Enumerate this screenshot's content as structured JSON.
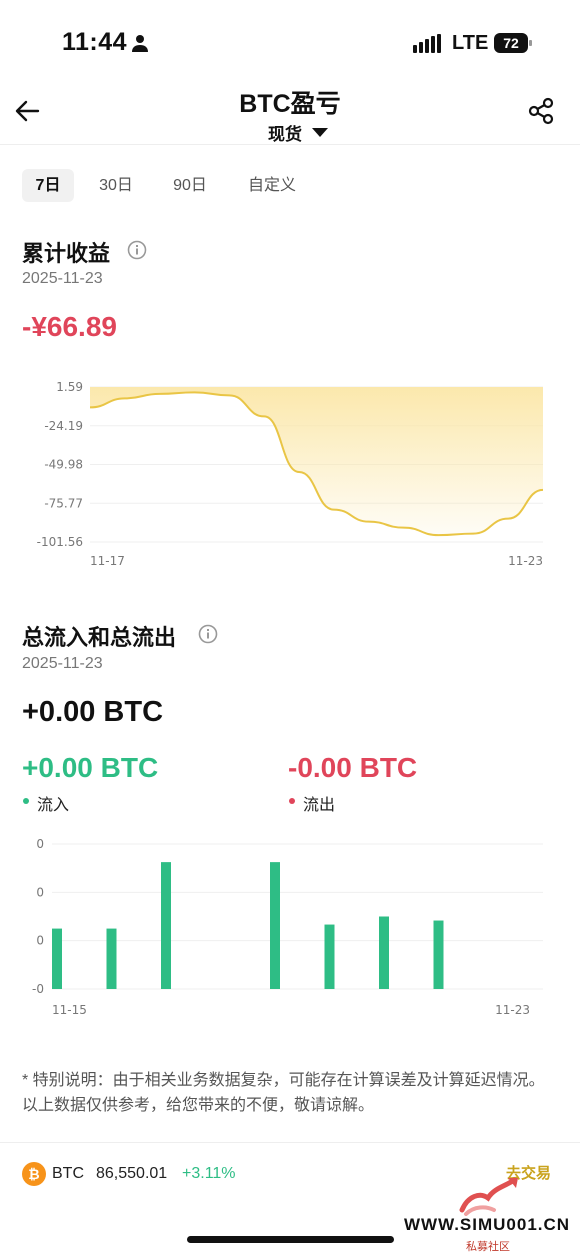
{
  "status_bar": {
    "time": "11:44",
    "network": "LTE",
    "battery": "72"
  },
  "header": {
    "title": "BTC盈亏",
    "market": "现货"
  },
  "tabs": [
    {
      "label": "7日",
      "active": true
    },
    {
      "label": "30日",
      "active": false
    },
    {
      "label": "90日",
      "active": false
    },
    {
      "label": "自定义",
      "active": false
    }
  ],
  "pnl": {
    "title": "累计收益",
    "date": "2025-11-23",
    "value": "-¥66.89"
  },
  "flows": {
    "title": "总流入和总流出",
    "date": "2025-11-23",
    "net": "+0.00 BTC",
    "inflow_value": "+0.00 BTC",
    "inflow_label": "流入",
    "outflow_value": "-0.00 BTC",
    "outflow_label": "流出"
  },
  "colors": {
    "positive": "#2ebd85",
    "negative": "#e0455a",
    "area_line": "#e9c545",
    "area_fill": "#fbe7a8"
  },
  "note": "* 特别说明：由于相关业务数据复杂，可能存在计算误差及计算延迟情况。以上数据仅供参考，给您带来的不便，敬请谅解。",
  "ticker": {
    "symbol": "BTC",
    "price": "86,550.01",
    "change": "+3.11%",
    "more": "去交易"
  },
  "watermark": {
    "site": "WWW.SIMU001.CN",
    "sub": "私募社区"
  },
  "chart_data": [
    {
      "type": "area",
      "title": "累计收益",
      "y_ticks": [
        "1.59",
        "-24.19",
        "-49.98",
        "-75.77",
        "-101.56"
      ],
      "x_tick_labels": [
        "11-17",
        "11-23"
      ],
      "ylim": [
        -101.56,
        1.59
      ],
      "x": [
        0,
        1,
        2,
        3,
        4,
        5,
        6,
        7,
        8,
        9,
        10,
        11,
        12,
        13
      ],
      "y": [
        -12,
        -6,
        -3,
        -2,
        -4,
        -18,
        -55,
        -80,
        -88,
        -92,
        -97,
        -96,
        -86,
        -66.89
      ],
      "grid": true
    },
    {
      "type": "bar",
      "title": "总流入和总流出",
      "y_ticks": [
        "0",
        "0",
        "0",
        "-0"
      ],
      "x_tick_labels": [
        "11-15",
        "11-23"
      ],
      "categories": [
        "11-15",
        "11-16",
        "11-17",
        "11-18",
        "11-19",
        "11-20",
        "11-21",
        "11-22",
        "11-23"
      ],
      "series": [
        {
          "name": "流入",
          "values": [
            0.3,
            0.3,
            0.63,
            0,
            0.63,
            0.32,
            0.36,
            0.34,
            0
          ]
        }
      ],
      "ylim": [
        0,
        0.72
      ],
      "grid": true
    }
  ]
}
